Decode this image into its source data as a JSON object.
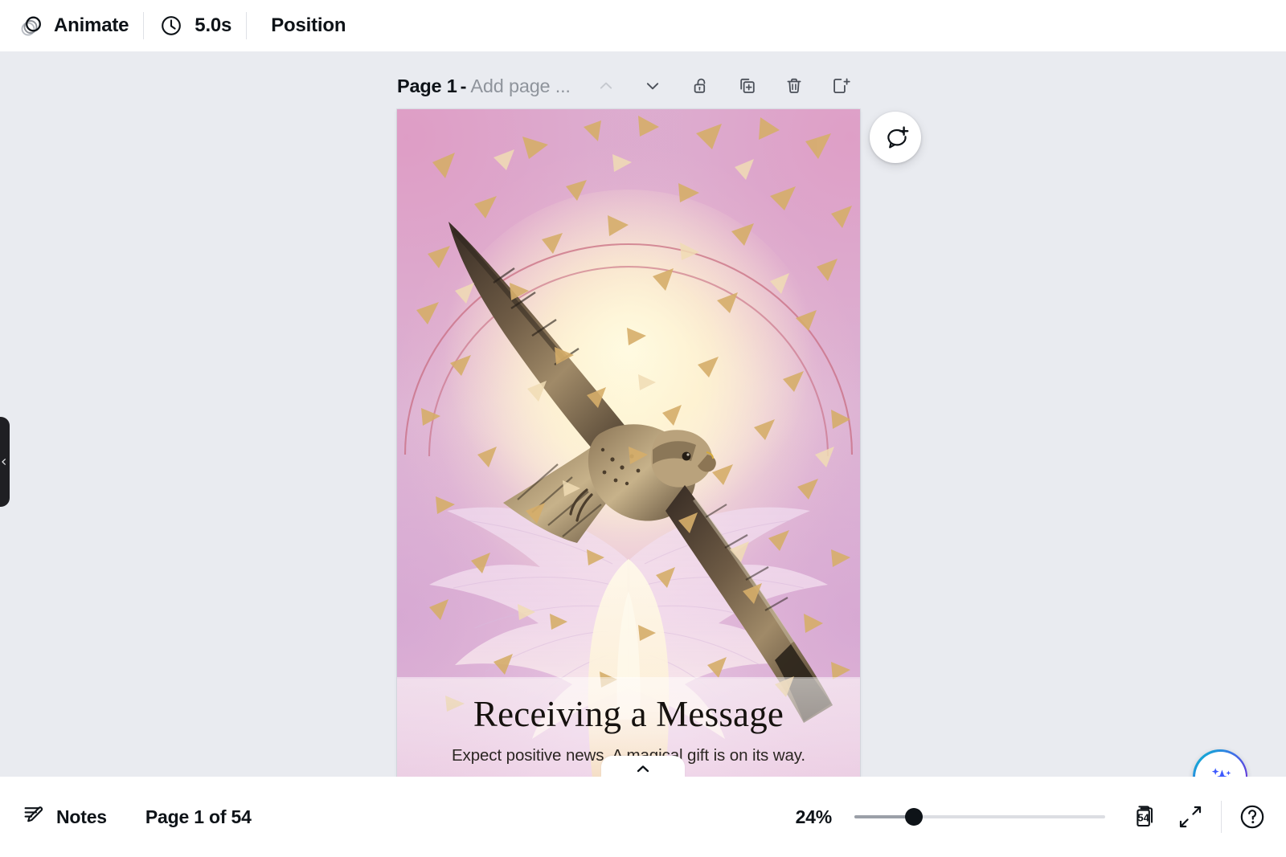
{
  "toolbar": {
    "animate_label": "Animate",
    "animate_icon": "stacked-circles-icon",
    "duration_label": "5.0s",
    "duration_icon": "clock-icon",
    "position_label": "Position"
  },
  "page_header": {
    "page_label": "Page 1",
    "separator": "-",
    "name_placeholder": "Add page ...",
    "icons": {
      "move_up": "chevron-up-icon",
      "move_down": "chevron-down-icon",
      "lock": "unlock-icon",
      "duplicate": "duplicate-page-icon",
      "delete": "trash-icon",
      "add_page": "add-page-icon"
    }
  },
  "card": {
    "title": "Receiving a Message",
    "subtitle": "Expect positive news. A magical gift is on its way.",
    "artwork_description": "Hawk in flight over glowing angel wings with golden confetti",
    "colors": {
      "background_pink": "#e9a5c6",
      "background_mauve": "#ddbad9",
      "glow_cream": "#fff8d7",
      "arch_rose": "#cf6f84",
      "rule_rose": "#cf6f84"
    }
  },
  "floating": {
    "comment_button": "add-comment-icon",
    "magic_button": "magic-studio-sparkle-icon",
    "magic_gradient": "#00c4cc → #6432d8",
    "panel_tab": "chevron-up-icon"
  },
  "sidebar_handle": {
    "icon": "chevron-left-icon"
  },
  "bottombar": {
    "notes_label": "Notes",
    "notes_icon": "notes-pencil-icon",
    "page_counter": "Page 1 of 54",
    "zoom_value": "24%",
    "zoom_slider": {
      "min": 0,
      "max": 100,
      "value": 24
    },
    "pages_count_badge": "54",
    "pages_icon": "grid-pages-icon",
    "fullscreen_icon": "expand-arrows-icon",
    "help_icon": "help-question-icon"
  }
}
